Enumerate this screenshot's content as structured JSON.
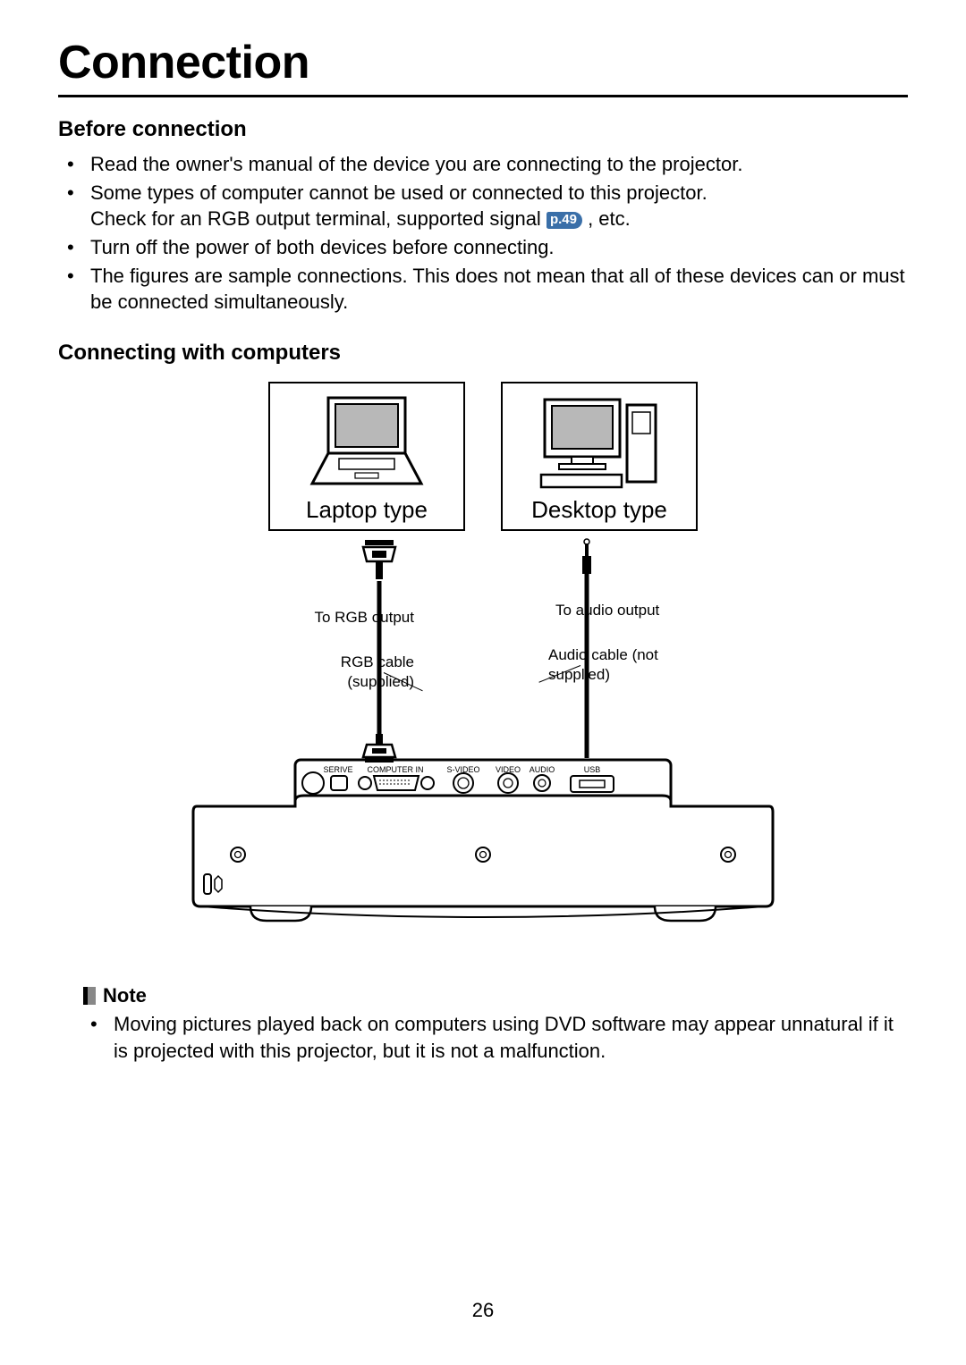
{
  "title": "Connection",
  "section_before": {
    "heading": "Before connection",
    "items": [
      "Read the owner's manual of the device you are connecting to the projector.",
      "Some types of computer cannot be used or connected to this projector.",
      "Turn off the power of both devices before connecting.",
      "The figures are sample connections. This does not mean that all of these devices can or must be connected simultaneously."
    ],
    "check_prefix": "Check for an RGB output terminal, supported signal ",
    "page_ref": "p.49",
    "check_suffix": " , etc."
  },
  "section_connect": {
    "heading": "Connecting with computers",
    "laptop_label": "Laptop type",
    "desktop_label": "Desktop type",
    "to_rgb": "To RGB output",
    "rgb_cable": "RGB cable (supplied)",
    "to_audio": "To audio output",
    "audio_cable": "Audio cable (not supplied)",
    "ports": {
      "service": "SERIVE",
      "computer_in": "COMPUTER IN",
      "svideo": "S-VIDEO",
      "video": "VIDEO",
      "audio": "AUDIO",
      "usb": "USB"
    }
  },
  "note": {
    "label": "Note",
    "items": [
      "Moving pictures played back on computers using DVD software may appear unnatural if it is projected with this projector, but it is not a malfunction."
    ]
  },
  "page_number": "26"
}
